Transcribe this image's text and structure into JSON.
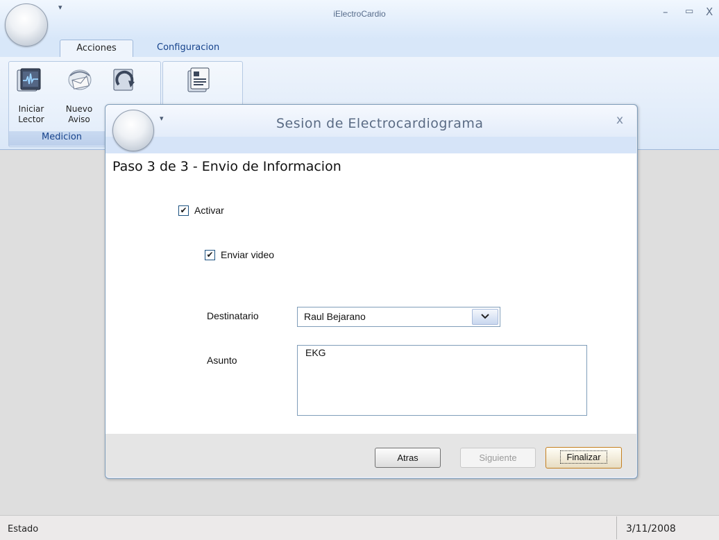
{
  "app": {
    "title": "iElectroCardio",
    "quick_access_glyph": "▾",
    "window_controls": {
      "minimize": "–",
      "maximize": "▭",
      "close": "X"
    }
  },
  "ribbon": {
    "tabs": [
      {
        "label": "Acciones",
        "selected": true
      },
      {
        "label": "Configuracion",
        "selected": false
      }
    ],
    "groups": [
      {
        "label": "Medicion",
        "buttons": [
          {
            "label_line1": "Iniciar",
            "label_line2": "Lector",
            "icon": "ecg-monitor-icon"
          },
          {
            "label_line1": "Nuevo",
            "label_line2": "Aviso",
            "icon": "mail-envelope-icon"
          },
          {
            "label_line1": "",
            "label_line2": "",
            "icon": "refresh-icon"
          }
        ]
      },
      {
        "label": "",
        "buttons": [
          {
            "label_line1": "",
            "label_line2": "",
            "icon": "document-icon"
          }
        ]
      }
    ]
  },
  "dialog": {
    "title": "Sesion de Electrocardiograma",
    "close_glyph": "x",
    "heading": "Paso 3 de 3 - Envio de Informacion",
    "activar": {
      "label": "Activar",
      "checked": true
    },
    "enviar_video": {
      "label": "Enviar video",
      "checked": true
    },
    "destinatario": {
      "label": "Destinatario",
      "value": "Raul Bejarano"
    },
    "asunto": {
      "label": "Asunto",
      "value": "EKG"
    },
    "buttons": {
      "atras": "Atras",
      "siguiente": "Siguiente",
      "finalizar": "Finalizar"
    },
    "check_glyph": "✔"
  },
  "status": {
    "text": "Estado",
    "date": "3/11/2008"
  },
  "colors": {
    "title_bar": "#d8e7f9",
    "ribbon_text": "#15428b",
    "desktop_bg": "#dedede",
    "finalize_border": "#c47f1f"
  }
}
